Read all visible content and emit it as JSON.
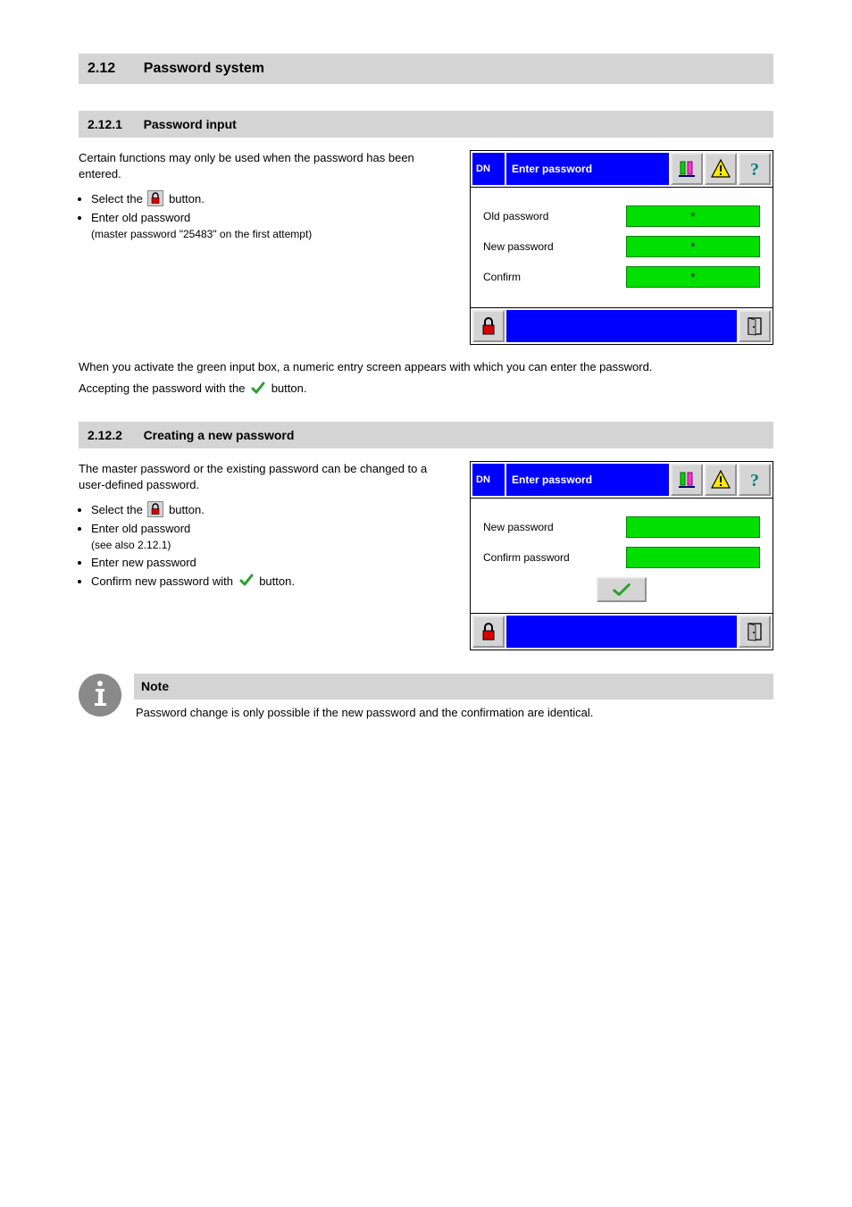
{
  "section": {
    "number": "2.12",
    "title": "Password system"
  },
  "sub1": {
    "number": "2.12.1",
    "title": "Password input",
    "intro": "Certain functions may only be used when the password has been entered.",
    "bullets_pre": "Select the",
    "bullets_post": "button.",
    "b1": "Enter old password",
    "b1_tail": "(master password \"25483\" on the first attempt)",
    "instr1a": "When you activate the green input box, a numeric entry screen appears with which you can enter the password.",
    "instr1b_pre": "Accepting the password with the",
    "instr1b_post": "button."
  },
  "screen1": {
    "code": "DN",
    "title": "Enter password",
    "row1_label": "Old password",
    "row2_label": "New password",
    "row3_label": "Confirm",
    "mask": "*"
  },
  "sub2": {
    "number": "2.12.2",
    "title": "Creating a new password",
    "intro": "The master password or the existing password can be changed to a user-defined password.",
    "bullets_pre": "Select the",
    "bullets_post": "button.",
    "b1": "Enter old password",
    "b1_tail": "(see also 2.12.1)",
    "b2": "Enter new password",
    "b3_pre": "Confirm new password with",
    "b3_post": "button."
  },
  "screen2": {
    "code": "DN",
    "title": "Enter password",
    "row1_label": "New password",
    "row2_label": "Confirm password"
  },
  "note": {
    "head": "Note",
    "body": "Password change is only possible if the new password and the confirmation are identical."
  },
  "icons": {
    "lock": "lock-icon",
    "check": "check-icon",
    "bars": "bars-icon",
    "warn": "warning-icon",
    "help": "help-icon",
    "door": "door-icon"
  }
}
